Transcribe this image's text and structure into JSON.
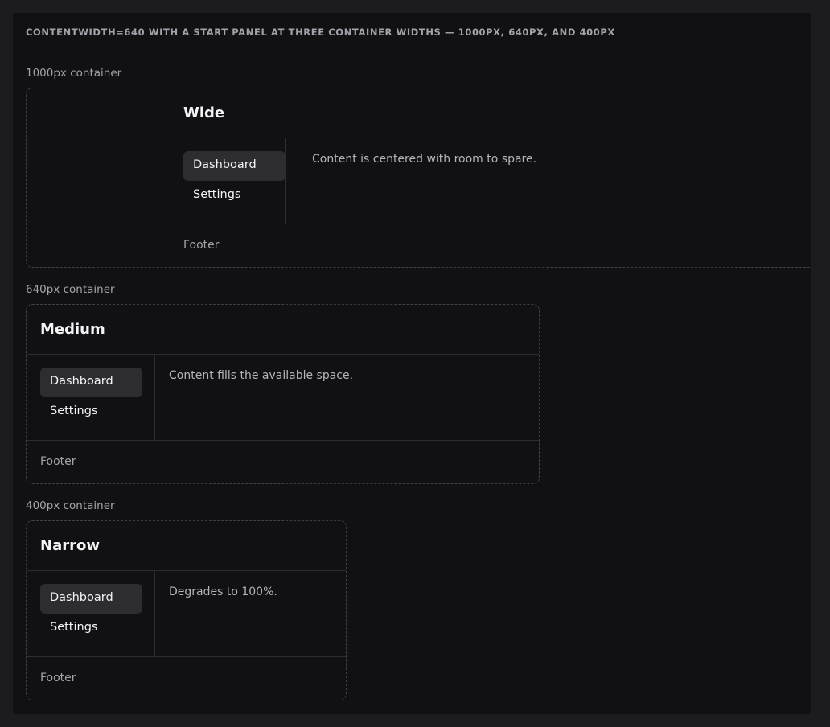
{
  "heading": "CONTENTWIDTH=640 WITH A START PANEL AT THREE CONTAINER WIDTHS — 1000PX, 640PX, AND 400PX",
  "demos": [
    {
      "label": "1000px container",
      "title": "Wide",
      "nav": [
        "Dashboard",
        "Settings"
      ],
      "active_nav": "Dashboard",
      "content": "Content is centered with room to spare.",
      "footer": "Footer"
    },
    {
      "label": "640px container",
      "title": "Medium",
      "nav": [
        "Dashboard",
        "Settings"
      ],
      "active_nav": "Dashboard",
      "content": "Content fills the available space.",
      "footer": "Footer"
    },
    {
      "label": "400px container",
      "title": "Narrow",
      "nav": [
        "Dashboard",
        "Settings"
      ],
      "active_nav": "Dashboard",
      "content": "Degrades to 100%.",
      "footer": "Footer"
    }
  ]
}
